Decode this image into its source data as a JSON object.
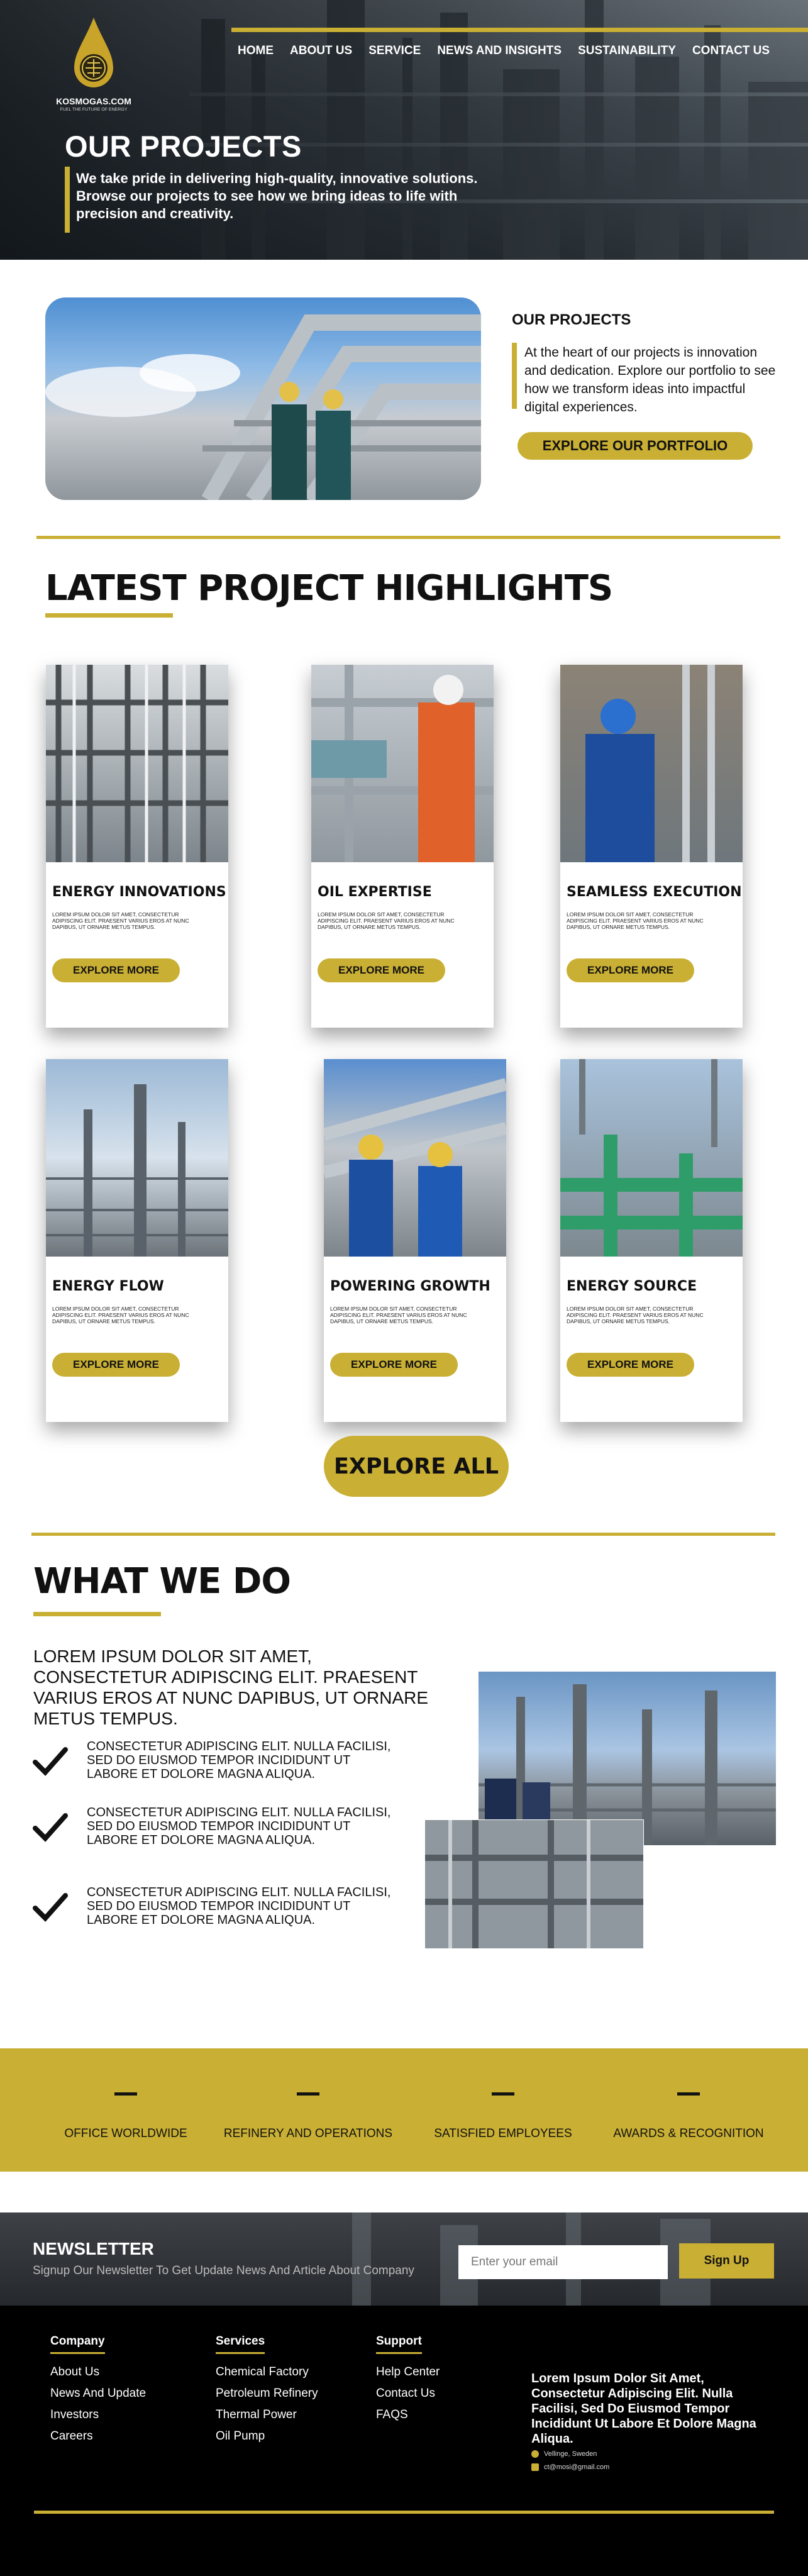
{
  "brand": {
    "name": "KOSMOGAS.COM",
    "tagline": "FUEL THE FUTURE OF ENERGY"
  },
  "nav": {
    "items": [
      "HOME",
      "ABOUT US",
      "SERVICE",
      "NEWS AND INSIGHTS",
      "SUSTAINABILITY",
      "CONTACT US"
    ]
  },
  "hero": {
    "title": "OUR PROJECTS",
    "subtitle": "We take pride in delivering high-quality, innovative solutions. Browse our projects to see how we bring ideas to life with precision and creativity."
  },
  "intro": {
    "title": "OUR PROJECTS",
    "text": "At the heart of our projects is innovation and dedication.  Explore our portfolio to see how we transform ideas into impactful digital experiences.",
    "button": "EXPLORE OUR PORTFOLIO"
  },
  "highlights": {
    "title": "LATEST PROJECT HIGHLIGHTS",
    "cards": [
      {
        "title": "ENERGY INNOVATIONS",
        "text": "LOREM IPSUM DOLOR SIT AMET, CONSECTETUR ADIPISCING ELIT. PRAESENT VARIUS EROS AT NUNC DAPIBUS, UT ORNARE METUS TEMPUS.",
        "button": "EXPLORE MORE"
      },
      {
        "title": "OIL EXPERTISE",
        "text": "LOREM IPSUM DOLOR SIT AMET, CONSECTETUR ADIPISCING ELIT. PRAESENT VARIUS EROS AT NUNC DAPIBUS, UT ORNARE METUS TEMPUS.",
        "button": "EXPLORE MORE"
      },
      {
        "title": "SEAMLESS EXECUTION",
        "text": "LOREM IPSUM DOLOR SIT AMET, CONSECTETUR ADIPISCING ELIT. PRAESENT VARIUS EROS AT NUNC DAPIBUS, UT ORNARE METUS TEMPUS.",
        "button": "EXPLORE MORE"
      },
      {
        "title": "ENERGY FLOW",
        "text": "LOREM IPSUM DOLOR SIT AMET, CONSECTETUR ADIPISCING ELIT. PRAESENT VARIUS EROS AT NUNC DAPIBUS, UT ORNARE METUS TEMPUS.",
        "button": "EXPLORE MORE"
      },
      {
        "title": "POWERING GROWTH",
        "text": "LOREM IPSUM DOLOR SIT AMET, CONSECTETUR ADIPISCING ELIT. PRAESENT VARIUS EROS AT NUNC DAPIBUS, UT ORNARE METUS TEMPUS.",
        "button": "EXPLORE MORE"
      },
      {
        "title": "ENERGY SOURCE",
        "text": "LOREM IPSUM DOLOR SIT AMET, CONSECTETUR ADIPISCING ELIT. PRAESENT VARIUS EROS AT NUNC DAPIBUS, UT ORNARE METUS TEMPUS.",
        "button": "EXPLORE MORE"
      }
    ],
    "explore_all": "EXPLORE ALL"
  },
  "what_we_do": {
    "title": "WHAT WE DO",
    "lead": "LOREM IPSUM DOLOR SIT AMET, CONSECTETUR ADIPISCING ELIT. PRAESENT VARIUS EROS AT NUNC DAPIBUS, UT ORNARE METUS TEMPUS.",
    "features": [
      "CONSECTETUR ADIPISCING ELIT. NULLA FACILISI, SED DO EIUSMOD TEMPOR INCIDIDUNT UT LABORE ET DOLORE MAGNA ALIQUA.",
      "CONSECTETUR ADIPISCING ELIT. NULLA FACILISI, SED DO EIUSMOD TEMPOR INCIDIDUNT UT LABORE ET DOLORE MAGNA ALIQUA.",
      "CONSECTETUR ADIPISCING ELIT. NULLA FACILISI, SED DO EIUSMOD TEMPOR INCIDIDUNT UT LABORE ET DOLORE MAGNA ALIQUA."
    ]
  },
  "stats": {
    "items": [
      {
        "value": "–",
        "label": "OFFICE WORLDWIDE"
      },
      {
        "value": "–",
        "label": "REFINERY AND OPERATIONS"
      },
      {
        "value": "–",
        "label": "SATISFIED EMPLOYEES"
      },
      {
        "value": "–",
        "label": "AWARDS & RECOGNITION"
      }
    ]
  },
  "newsletter": {
    "title": "NEWSLETTER",
    "subtitle": "Signup Our Newsletter To Get Update News And Article About Company",
    "placeholder": "Enter your email",
    "button": "Sign Up"
  },
  "footer": {
    "company": {
      "title": "Company",
      "links": [
        "About Us",
        "News And Update",
        "Investors",
        "Careers"
      ]
    },
    "services": {
      "title": "Services",
      "links": [
        "Chemical Factory",
        "Petroleum Refinery",
        "Thermal Power",
        "Oil Pump"
      ]
    },
    "support": {
      "title": "Support",
      "links": [
        "Help Center",
        "Contact Us",
        "FAQS"
      ]
    },
    "about": "Lorem Ipsum Dolor Sit Amet, Consectetur Adipiscing Elit. Nulla Facilisi, Sed Do Eiusmod Tempor Incididunt Ut Labore Et Dolore Magna Aliqua.",
    "location": "Vellinge, Sweden",
    "email": "ct@mosi@gmail.com"
  },
  "colors": {
    "accent": "#c9af33",
    "dark": "#000000",
    "text": "#111111"
  }
}
